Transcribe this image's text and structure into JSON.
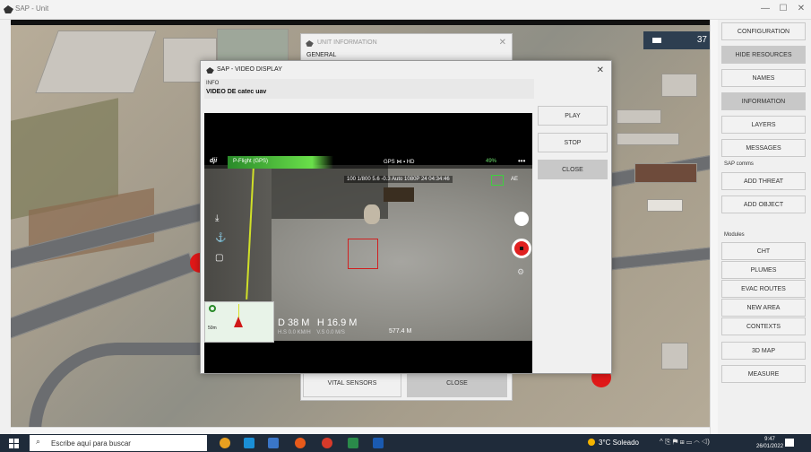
{
  "window": {
    "title": "SAP - Unit",
    "controls": [
      "—",
      "☐",
      "✕"
    ]
  },
  "map": {
    "overlay_value": "37"
  },
  "unit_info": {
    "title": "UNIT INFORMATION",
    "section": "GENERAL",
    "vital_sensors_label": "VITAL SENSORS",
    "close_label": "CLOSE"
  },
  "video_display": {
    "title": "SAP - VIDEO DISPLAY",
    "info_label": "INFO",
    "info_value": "VIDEO DE catec uav",
    "buttons": {
      "play": "PLAY",
      "stop": "STOP",
      "close": "CLOSE"
    },
    "feed": {
      "logo": "dji",
      "flight_mode": "P-Flight (GPS)",
      "status": "GPS  ⋈  ▪  HD  ",
      "battery": "49%",
      "more": "•••",
      "camera_settings": "100  1/800  5.6   -0.3  Auto   1080P 24  04:34:46",
      "ae": "AE",
      "minimap_scale": "50m",
      "distance": "D 38 M",
      "height": "H 16.9 M",
      "hspeed": "H.S 0.0 KM/H",
      "vspeed": "V.S 0.0 M/S",
      "home_distance": "577.4 M"
    }
  },
  "right_panel": {
    "buttons": [
      {
        "label": "CONFIGURATION",
        "active": false
      },
      {
        "label": "HIDE RESOURCES",
        "active": true
      },
      {
        "label": "NAMES",
        "active": false
      },
      {
        "label": "INFORMATION",
        "active": true
      },
      {
        "label": "LAYERS",
        "active": false
      },
      {
        "label": "MESSAGES",
        "active": false
      }
    ],
    "sap_comms_label": "SAP comms",
    "comms_buttons": [
      "ADD THREAT",
      "ADD OBJECT"
    ],
    "modules_label": "Modules",
    "module_buttons": [
      "CHT",
      "PLUMES",
      "EVAC ROUTES",
      "NEW AREA",
      "CONTEXTS"
    ],
    "extra_buttons": [
      "3D MAP",
      "MEASURE"
    ]
  },
  "taskbar": {
    "search_placeholder": "Escribe aquí para buscar",
    "weather": "3°C  Soleado",
    "time": "9:47",
    "date": "26/01/2022"
  },
  "colors": {
    "taskbar": "#1f2b3a",
    "record": "#e02020",
    "flight_bar": "#6ae04a"
  }
}
